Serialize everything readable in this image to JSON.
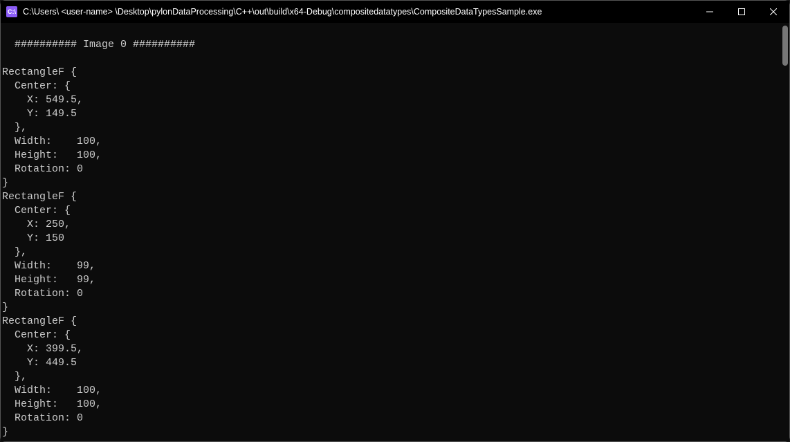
{
  "window": {
    "icon_text": "C:\\",
    "title": "C:\\Users\\ <user-name> \\Desktop\\pylonDataProcessing\\C++\\out\\build\\x64-Debug\\compositedatatypes\\CompositeDataTypesSample.exe"
  },
  "terminal": {
    "content": "########## Image 0 ##########\n\nRectangleF {\n  Center: {\n    X: 549.5,\n    Y: 149.5\n  },\n  Width:    100,\n  Height:   100,\n  Rotation: 0\n}\nRectangleF {\n  Center: {\n    X: 250,\n    Y: 150\n  },\n  Width:    99,\n  Height:   99,\n  Rotation: 0\n}\nRectangleF {\n  Center: {\n    X: 399.5,\n    Y: 449.5\n  },\n  Width:    100,\n  Height:   100,\n  Rotation: 0\n}"
  }
}
